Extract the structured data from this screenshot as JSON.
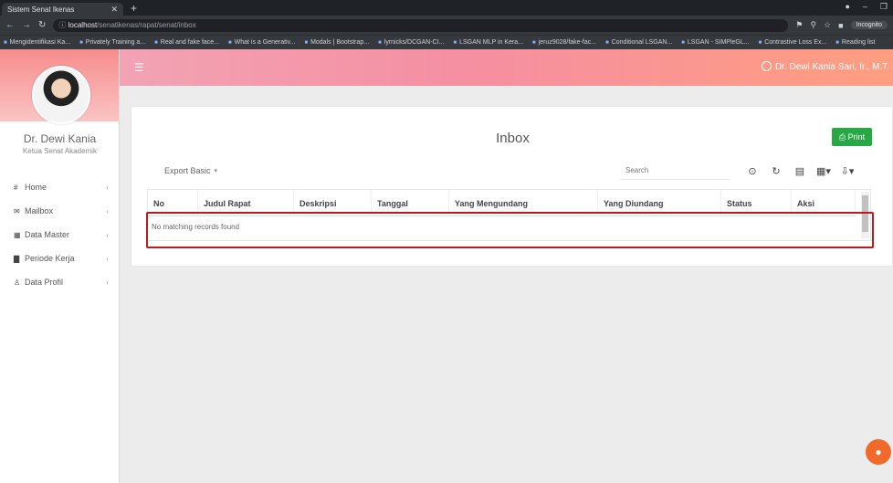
{
  "browser": {
    "tab_title": "Sistem Senat Ikenas",
    "url_host": "localhost",
    "url_path": "/senatikenas/rapat/senat/inbox",
    "incognito_label": "Incognito",
    "bookmarks": [
      "Mengidentifikasi Ka...",
      "Privately Training a...",
      "Real and fake face...",
      "What is a Generativ...",
      "Modals | Bootstrap...",
      "lyrnicks/DCGAN-CI...",
      "LSGAN MLP in Kera...",
      "jeruz9028/fake-fac...",
      "Conditional LSGAN...",
      "LSGAN - SIMPleGL...",
      "Contrastive Loss Ex...",
      "Reading list"
    ]
  },
  "sidebar": {
    "user_name": "Dr. Dewi Kania",
    "user_role": "Ketua Senat Akademik",
    "items": [
      {
        "label": "Home",
        "icon": "home-icon",
        "glyph": "#"
      },
      {
        "label": "Mailbox",
        "icon": "envelope-icon",
        "glyph": "✉"
      },
      {
        "label": "Data Master",
        "icon": "table-icon",
        "glyph": "▦"
      },
      {
        "label": "Periode Kerja",
        "icon": "bar-chart-icon",
        "glyph": "▇"
      },
      {
        "label": "Data Profil",
        "icon": "user-icon",
        "glyph": "♙"
      }
    ]
  },
  "topnav": {
    "menu_icon": "hamburger-icon",
    "user_label": "Dr. Dewi Kania Sari, Ir., M.T."
  },
  "card": {
    "title": "Inbox",
    "print_label": "Print",
    "export_label": "Export Basic",
    "search_placeholder": "Search",
    "tool_icons": [
      "toggle-icon",
      "refresh-icon",
      "card-view-icon",
      "columns-icon",
      "export-icon"
    ],
    "columns": [
      "No",
      "Judul Rapat",
      "Deskripsi",
      "Tanggal",
      "Yang Mengundang",
      "Yang Diundang",
      "Status",
      "Aksi"
    ],
    "empty_message": "No matching records found"
  },
  "colors": {
    "accent_green": "#28a745",
    "highlight_red": "#b81c1c",
    "fab_orange": "#f16a2b"
  }
}
